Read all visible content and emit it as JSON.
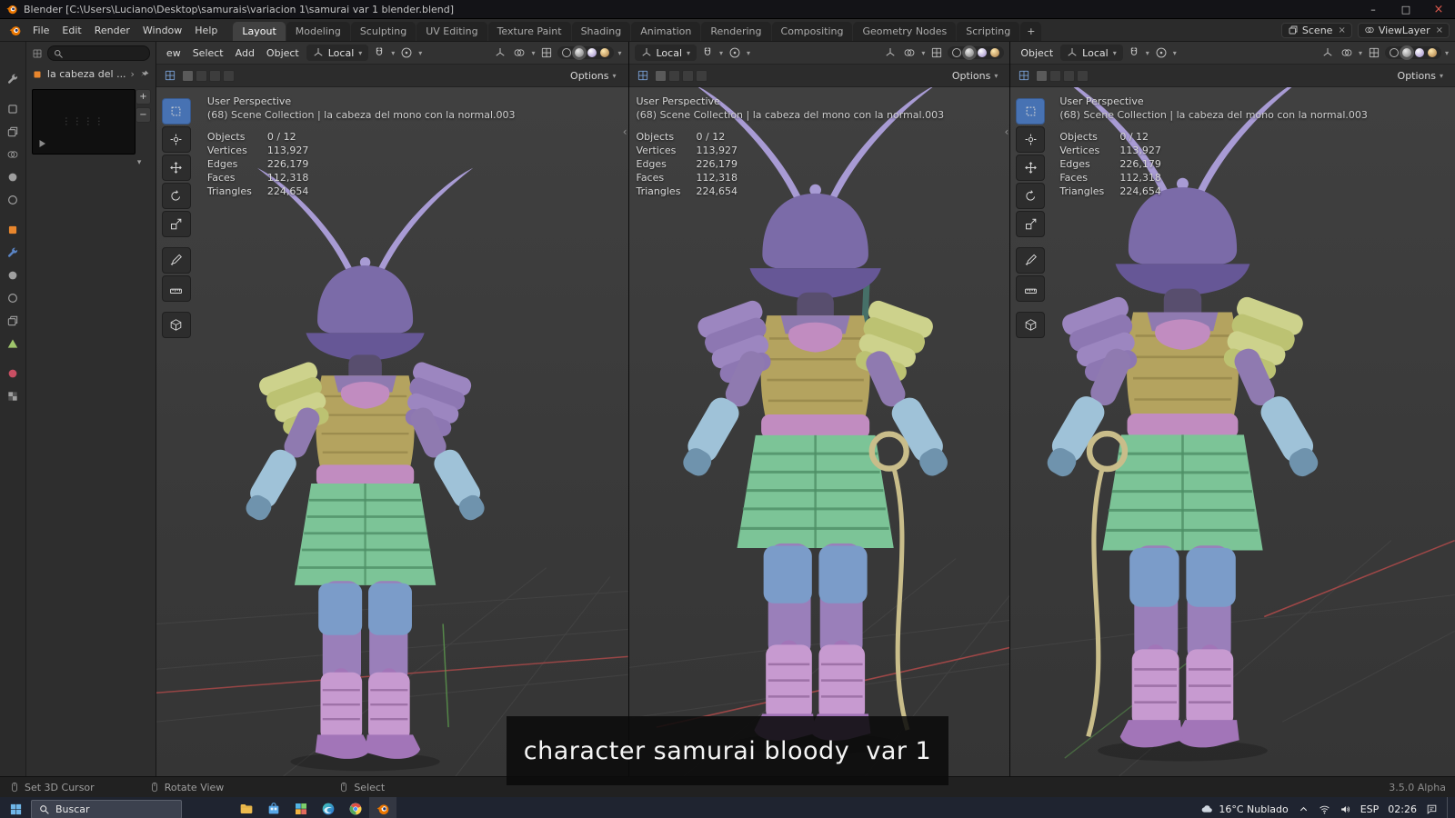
{
  "colors": {
    "horn": "#a89bd4",
    "helmet": "#7b6ba8",
    "helmet-dark": "#665796",
    "face": "#584e6e",
    "chest": "#b4a35f",
    "chest-line": "#8f7f45",
    "sode-yellow": "#cdd28c",
    "sode-yellow2": "#bcc272",
    "sode-purple": "#9c86c0",
    "sode-purple2": "#8d77b2",
    "arm": "#8f7ab0",
    "glove": "#9fc2d8",
    "glove-dark": "#6f93ad",
    "sash": "#c18cc0",
    "sash-dark": "#a873a8",
    "skirt": "#7cc497",
    "skirt-line": "#4e8f66",
    "shorts": "#7b9cc9",
    "thigh": "#9a7fba",
    "shin": "#c79ad0",
    "shin-line": "#93689e",
    "boot": "#a275b8",
    "rope": "#c9bd8a",
    "accent-blue": "#4772b3",
    "axis-green": "#5c9b4e",
    "axis-red": "#b04a4a"
  },
  "titlebar": {
    "title": "Blender [C:\\Users\\Luciano\\Desktop\\samurais\\variacion 1\\samurai var 1 blender.blend]",
    "minimize": "–",
    "maximize": "□",
    "close": "×"
  },
  "topbar": {
    "menus": [
      "File",
      "Edit",
      "Render",
      "Window",
      "Help"
    ],
    "workspaces": [
      "Layout",
      "Modeling",
      "Sculpting",
      "UV Editing",
      "Texture Paint",
      "Shading",
      "Animation",
      "Rendering",
      "Compositing",
      "Geometry Nodes",
      "Scripting"
    ],
    "add_workspace": "+",
    "scene": "Scene",
    "view_layer": "ViewLayer"
  },
  "sidepanel": {
    "breadcrumb": "la cabeza del ..."
  },
  "viewports": [
    {
      "menus": [
        "ew",
        "Select",
        "Add",
        "Object"
      ],
      "orientation": "Local",
      "options": "Options",
      "perspective": "User Perspective",
      "collection": "(68) Scene Collection | la cabeza del mono con la normal.003",
      "stats": {
        "objects": {
          "label": "Objects",
          "value": "0 / 12"
        },
        "vertices": {
          "label": "Vertices",
          "value": "113,927"
        },
        "edges": {
          "label": "Edges",
          "value": "226,179"
        },
        "faces": {
          "label": "Faces",
          "value": "112,318"
        },
        "triangles": {
          "label": "Triangles",
          "value": "224,654"
        }
      }
    },
    {
      "menus": [],
      "orientation": "Local",
      "options": "Options",
      "perspective": "User Perspective",
      "collection": "(68) Scene Collection | la cabeza del mono con la normal.003",
      "stats": {
        "objects": {
          "label": "Objects",
          "value": "0 / 12"
        },
        "vertices": {
          "label": "Vertices",
          "value": "113,927"
        },
        "edges": {
          "label": "Edges",
          "value": "226,179"
        },
        "faces": {
          "label": "Faces",
          "value": "112,318"
        },
        "triangles": {
          "label": "Triangles",
          "value": "224,654"
        }
      }
    },
    {
      "menus": [
        "Object"
      ],
      "orientation": "Local",
      "options": "Options",
      "perspective": "User Perspective",
      "collection": "(68) Scene Collection | la cabeza del mono con la normal.003",
      "stats": {
        "objects": {
          "label": "Objects",
          "value": "0 / 12"
        },
        "vertices": {
          "label": "Vertices",
          "value": "113,927"
        },
        "edges": {
          "label": "Edges",
          "value": "226,179"
        },
        "faces": {
          "label": "Faces",
          "value": "112,318"
        },
        "triangles": {
          "label": "Triangles",
          "value": "224,654"
        }
      }
    }
  ],
  "caption": {
    "text": "character samurai bloody  var 1"
  },
  "statusbar": {
    "set_cursor": "Set 3D Cursor",
    "rotate_view": "Rotate View",
    "select": "Select",
    "version": "3.5.0 Alpha"
  },
  "taskbar": {
    "search": "Buscar",
    "weather": "16°C Nublado",
    "lang": "ESP",
    "time": "02:26"
  }
}
